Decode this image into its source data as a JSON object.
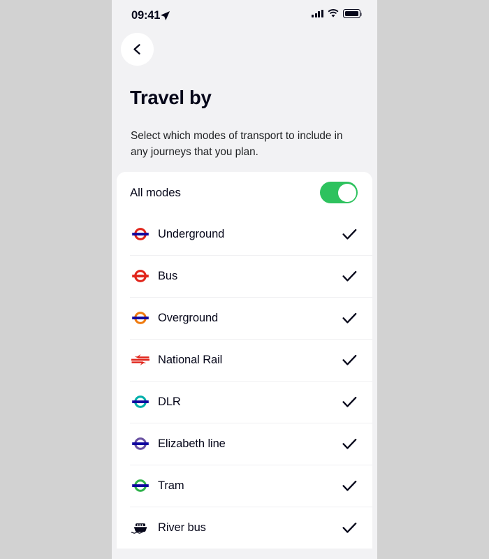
{
  "status_bar": {
    "time": "09:41",
    "location_icon": "location-arrow-icon",
    "signal_icon": "cellular-signal-icon",
    "wifi_icon": "wifi-icon",
    "battery_icon": "battery-full-icon"
  },
  "nav": {
    "back_icon": "chevron-left-icon",
    "back_label": "Back"
  },
  "header": {
    "title": "Travel by",
    "subtitle": "Select which modes of transport to include in any journeys that you plan."
  },
  "all_modes": {
    "label": "All modes",
    "toggle_on": true,
    "toggle_color": "#2ec25e",
    "toggle_knob_color": "#ffffff"
  },
  "modes": [
    {
      "label": "Underground",
      "icon": "underground-roundel-icon",
      "ring_color": "#e1251b",
      "bar_color": "#10069f",
      "checked": true
    },
    {
      "label": "Bus",
      "icon": "bus-roundel-icon",
      "ring_color": "#e1251b",
      "bar_color": "#e1251b",
      "checked": true
    },
    {
      "label": "Overground",
      "icon": "overground-roundel-icon",
      "ring_color": "#ef7b10",
      "bar_color": "#10069f",
      "checked": true
    },
    {
      "label": "National Rail",
      "icon": "national-rail-double-arrow-icon",
      "ring_color": "#e1251b",
      "bar_color": "#e1251b",
      "checked": true
    },
    {
      "label": "DLR",
      "icon": "dlr-roundel-icon",
      "ring_color": "#00afaa",
      "bar_color": "#10069f",
      "checked": true
    },
    {
      "label": "Elizabeth line",
      "icon": "elizabeth-line-roundel-icon",
      "ring_color": "#6950a1",
      "bar_color": "#10069f",
      "checked": true
    },
    {
      "label": "Tram",
      "icon": "tram-roundel-icon",
      "ring_color": "#2fb24c",
      "bar_color": "#10069f",
      "checked": true
    },
    {
      "label": "River bus",
      "icon": "river-bus-boat-icon",
      "ring_color": "#06071a",
      "bar_color": "#06071a",
      "checked": true
    }
  ],
  "check_icon": "checkmark-icon",
  "colors": {
    "page_background": "#d2d2d2",
    "screen_background": "#f2f2f4",
    "card_background": "#ffffff",
    "text_primary": "#06071a",
    "divider": "#f0f0f2"
  }
}
